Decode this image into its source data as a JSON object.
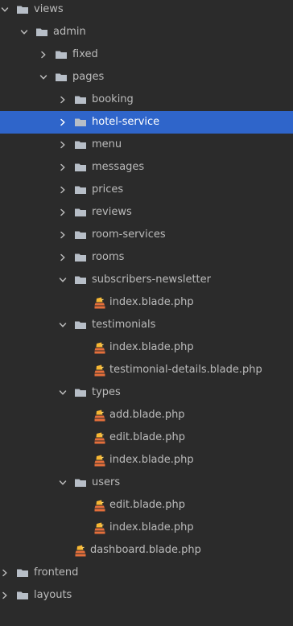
{
  "tree": [
    {
      "label": "views",
      "type": "folder",
      "depth": 0,
      "expanded": true,
      "selected": false
    },
    {
      "label": "admin",
      "type": "folder",
      "depth": 1,
      "expanded": true,
      "selected": false
    },
    {
      "label": "fixed",
      "type": "folder",
      "depth": 2,
      "expanded": false,
      "selected": false
    },
    {
      "label": "pages",
      "type": "folder",
      "depth": 2,
      "expanded": true,
      "selected": false
    },
    {
      "label": "booking",
      "type": "folder",
      "depth": 3,
      "expanded": false,
      "selected": false
    },
    {
      "label": "hotel-service",
      "type": "folder",
      "depth": 3,
      "expanded": false,
      "selected": true
    },
    {
      "label": "menu",
      "type": "folder",
      "depth": 3,
      "expanded": false,
      "selected": false
    },
    {
      "label": "messages",
      "type": "folder",
      "depth": 3,
      "expanded": false,
      "selected": false
    },
    {
      "label": "prices",
      "type": "folder",
      "depth": 3,
      "expanded": false,
      "selected": false
    },
    {
      "label": "reviews",
      "type": "folder",
      "depth": 3,
      "expanded": false,
      "selected": false
    },
    {
      "label": "room-services",
      "type": "folder",
      "depth": 3,
      "expanded": false,
      "selected": false
    },
    {
      "label": "rooms",
      "type": "folder",
      "depth": 3,
      "expanded": false,
      "selected": false
    },
    {
      "label": "subscribers-newsletter",
      "type": "folder",
      "depth": 3,
      "expanded": true,
      "selected": false
    },
    {
      "label": "index.blade.php",
      "type": "file",
      "depth": 4,
      "selected": false
    },
    {
      "label": "testimonials",
      "type": "folder",
      "depth": 3,
      "expanded": true,
      "selected": false
    },
    {
      "label": "index.blade.php",
      "type": "file",
      "depth": 4,
      "selected": false
    },
    {
      "label": "testimonial-details.blade.php",
      "type": "file",
      "depth": 4,
      "selected": false
    },
    {
      "label": "types",
      "type": "folder",
      "depth": 3,
      "expanded": true,
      "selected": false
    },
    {
      "label": "add.blade.php",
      "type": "file",
      "depth": 4,
      "selected": false
    },
    {
      "label": "edit.blade.php",
      "type": "file",
      "depth": 4,
      "selected": false
    },
    {
      "label": "index.blade.php",
      "type": "file",
      "depth": 4,
      "selected": false
    },
    {
      "label": "users",
      "type": "folder",
      "depth": 3,
      "expanded": true,
      "selected": false
    },
    {
      "label": "edit.blade.php",
      "type": "file",
      "depth": 4,
      "selected": false
    },
    {
      "label": "index.blade.php",
      "type": "file",
      "depth": 4,
      "selected": false
    },
    {
      "label": "dashboard.blade.php",
      "type": "file",
      "depth": 3,
      "selected": false
    },
    {
      "label": "frontend",
      "type": "folder",
      "depth": 0,
      "expanded": false,
      "selected": false
    },
    {
      "label": "layouts",
      "type": "folder",
      "depth": 0,
      "expanded": false,
      "selected": false
    }
  ],
  "colors": {
    "background": "#2b2b2b",
    "text": "#bbbbbb",
    "selected_background": "#2f65ca",
    "selected_text": "#ffffff",
    "folder": "#b7bec7",
    "file_orange": "#e56f3b",
    "file_yellow": "#f7b733"
  }
}
